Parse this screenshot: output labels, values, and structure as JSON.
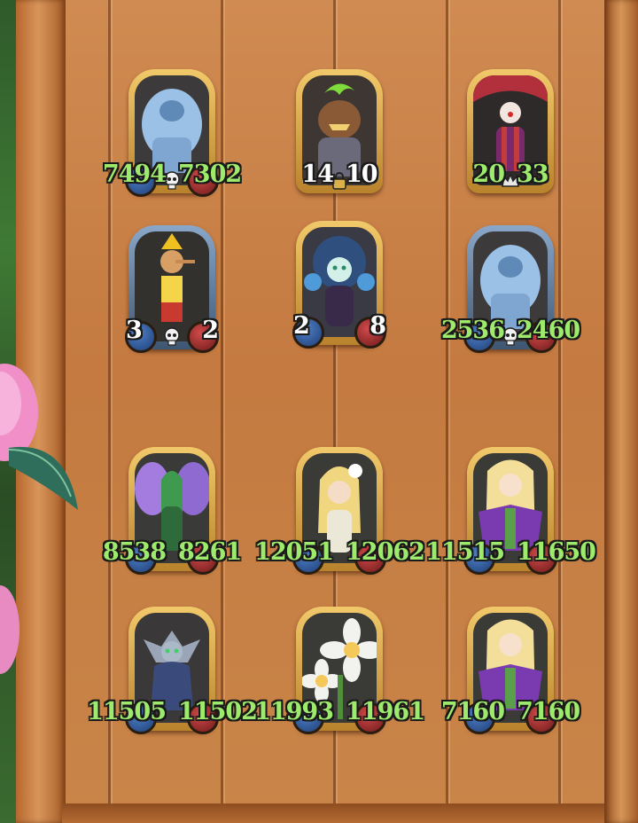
{
  "colors": {
    "wood": "#c9824a",
    "stat_green": "#9eea6c",
    "stat_white": "#ffffff",
    "atk_badge": "#2f5fa8",
    "hp_badge": "#a83434",
    "frame_gold": "#d9a64a"
  },
  "cards": [
    {
      "name": "Ice Golem",
      "icon": "skull-icon",
      "attack": "7494",
      "health": "7302",
      "stat_color": "green"
    },
    {
      "name": "Pumpkin Knight",
      "icon": "lock-icon",
      "attack": "14",
      "health": "10",
      "stat_color": "white"
    },
    {
      "name": "Clown",
      "icon": "crown-icon",
      "attack": "20",
      "health": "33",
      "stat_color": "green"
    },
    {
      "name": "Pinocchio",
      "icon": "skull-icon",
      "attack": "3",
      "health": "2",
      "stat_color": "white"
    },
    {
      "name": "Water Nymph",
      "icon": "",
      "attack": "2",
      "health": "8",
      "stat_color": "white"
    },
    {
      "name": "Ice Golem",
      "icon": "skull-icon",
      "attack": "2536",
      "health": "2460",
      "stat_color": "green"
    },
    {
      "name": "Violet Fairy",
      "icon": "",
      "attack": "8538",
      "health": "8261",
      "stat_color": "green"
    },
    {
      "name": "Flower Elf",
      "icon": "target-icon",
      "attack": "12051",
      "health": "12062",
      "stat_color": "green"
    },
    {
      "name": "Wisteria Maiden",
      "icon": "",
      "attack": "11515",
      "health": "11650",
      "stat_color": "green"
    },
    {
      "name": "Dark Elf",
      "icon": "",
      "attack": "11505",
      "health": "11502",
      "stat_color": "green"
    },
    {
      "name": "Singing Flowers",
      "icon": "",
      "attack": "11993",
      "health": "11961",
      "stat_color": "green"
    },
    {
      "name": "Wisteria Maiden",
      "icon": "",
      "attack": "7160",
      "health": "7160",
      "stat_color": "green"
    }
  ]
}
